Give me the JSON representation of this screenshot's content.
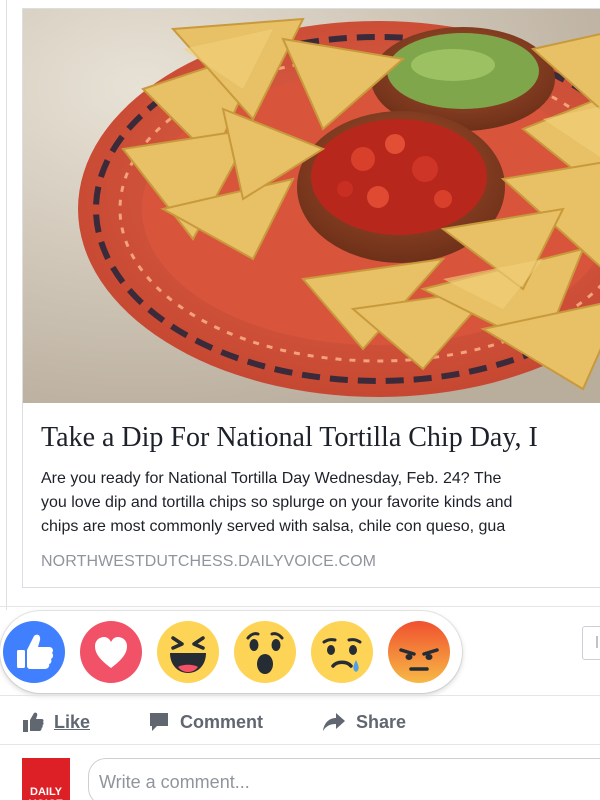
{
  "link_preview": {
    "image_alt": "Tortilla chips with salsa and guacamole on a decorated plate",
    "title": "Take a Dip For National Tortilla Chip Day, I",
    "description_lines": [
      "Are you ready for National Tortilla Day Wednesday, Feb. 24? The",
      "you love dip and tortilla chips so splurge on your favorite kinds and",
      "chips are most commonly served with salsa, chile con queso, gua"
    ],
    "domain": "NORTHWESTDUTCHESS.DAILYVOICE.COM"
  },
  "reactions": [
    {
      "icon": "like-reaction-icon"
    },
    {
      "icon": "love-reaction-icon"
    },
    {
      "icon": "haha-reaction-icon"
    },
    {
      "icon": "wow-reaction-icon"
    },
    {
      "icon": "sad-reaction-icon"
    },
    {
      "icon": "angry-reaction-icon"
    }
  ],
  "actions": {
    "like_label": "Like",
    "comment_label": "Comment",
    "share_label": "Share"
  },
  "comment": {
    "placeholder": "Write a comment...",
    "avatar_text": "DAILY VOICE"
  },
  "colors": {
    "like_blue": "#4080ff",
    "love_red": "#f25268",
    "emoji_yellow": "#fed456",
    "angry_orange": "#f27a3a",
    "avatar_red": "#dd1f26",
    "muted_text": "#90949c"
  }
}
